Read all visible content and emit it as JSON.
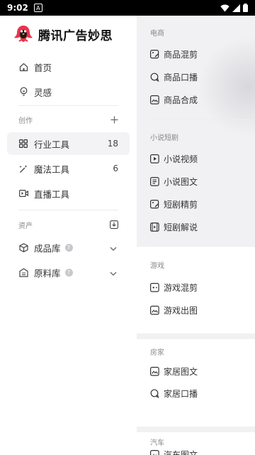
{
  "status": {
    "time": "9:02"
  },
  "brand": {
    "name": "腾讯广告妙思",
    "logo_icon": "penguin-logo"
  },
  "nav": {
    "home": "首页",
    "inspiration": "灵感"
  },
  "create": {
    "header": "创作",
    "items": [
      {
        "label": "行业工具",
        "count": "18"
      },
      {
        "label": "魔法工具",
        "count": "6"
      },
      {
        "label": "直播工具"
      }
    ]
  },
  "assets": {
    "header": "资产",
    "items": [
      {
        "label": "成品库"
      },
      {
        "label": "原料库"
      }
    ]
  },
  "categories": [
    {
      "title": "电商",
      "tools": [
        "商品混剪",
        "商品口播",
        "商品合成"
      ]
    },
    {
      "title": "小说短剧",
      "tools": [
        "小说视频",
        "小说图文",
        "短剧精剪",
        "短剧解说"
      ]
    },
    {
      "title": "游戏",
      "tools": [
        "游戏混剪",
        "游戏出图"
      ]
    },
    {
      "title": "房家",
      "tools": [
        "家居图文",
        "家居口播"
      ]
    },
    {
      "title": "汽车",
      "tools": [
        "汽车图文"
      ]
    }
  ],
  "colors": {
    "brand_red": "#e8344a",
    "active_bg": "#f3f3f6",
    "main_bg": "#f1f1f3"
  }
}
